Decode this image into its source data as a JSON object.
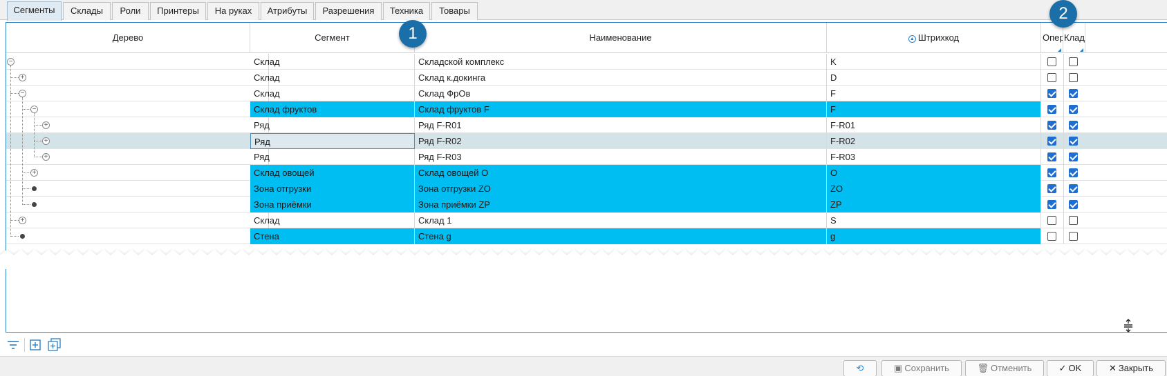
{
  "tabs": [
    {
      "label": "Сегменты",
      "active": true
    },
    {
      "label": "Склады"
    },
    {
      "label": "Роли"
    },
    {
      "label": "Принтеры"
    },
    {
      "label": "На руках"
    },
    {
      "label": "Атрибуты"
    },
    {
      "label": "Разрешения"
    },
    {
      "label": "Техника"
    },
    {
      "label": "Товары"
    }
  ],
  "grid": {
    "columns": {
      "tree": "Дерево",
      "segment": "Сегмент",
      "name": "Наименование",
      "barcode": "Штрихкод",
      "oper": "Опер",
      "klad": "Клад"
    },
    "rows": [
      {
        "segment": "Склад",
        "name": "Складской комплекс",
        "barcode": "K",
        "oper": false,
        "klad": false
      },
      {
        "segment": "Склад",
        "name": "Склад к.докинга",
        "barcode": "D",
        "oper": false,
        "klad": false
      },
      {
        "segment": "Склад",
        "name": "Склад ФрОв",
        "barcode": "F",
        "oper": true,
        "klad": true
      },
      {
        "segment": "Склад фруктов",
        "name": "Склад фруктов F",
        "barcode": "F",
        "oper": true,
        "klad": true
      },
      {
        "segment": "Ряд",
        "name": "Ряд F-R01",
        "barcode": "F-R01",
        "oper": true,
        "klad": true
      },
      {
        "segment": "Ряд",
        "name": "Ряд F-R02",
        "barcode": "F-R02",
        "oper": true,
        "klad": true
      },
      {
        "segment": "Ряд",
        "name": "Ряд F-R03",
        "barcode": "F-R03",
        "oper": true,
        "klad": true
      },
      {
        "segment": "Склад овощей",
        "name": "Склад овощей O",
        "barcode": "O",
        "oper": true,
        "klad": true
      },
      {
        "segment": "Зона отгрузки",
        "name": "Зона отгрузки ZO",
        "barcode": "ZO",
        "oper": true,
        "klad": true
      },
      {
        "segment": "Зона приёмки",
        "name": "Зона приёмки ZP",
        "barcode": "ZP",
        "oper": true,
        "klad": true
      },
      {
        "segment": "Склад",
        "name": "Склад 1",
        "barcode": "S",
        "oper": false,
        "klad": false
      },
      {
        "segment": "Стена",
        "name": "Стена g",
        "barcode": "g",
        "oper": false,
        "klad": false
      }
    ]
  },
  "badges": {
    "one": "1",
    "two": "2"
  },
  "footer": {
    "save": "Сохранить",
    "cancel": "Отменить",
    "ok": "OK",
    "close": "Закрыть"
  },
  "colors": {
    "selection": "#00bdf2",
    "accent": "#1a6fa8"
  }
}
